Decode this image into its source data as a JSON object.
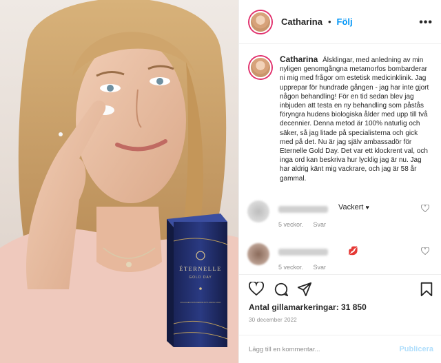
{
  "photo": {
    "box": {
      "brand": "ÉTERNELLE",
      "line": "GOLD DAY",
      "sub": "COLLAGEN SKIN REPAIR ANTI-AGING GOLD"
    }
  },
  "post": {
    "username": "Catharina",
    "separator": "•",
    "follow_label": "Följ",
    "more_icon": "more-options-icon",
    "caption_text": "Älsklingar, med anledning av min nyligen genomgångna metamorfos bombarderar ni mig med frågor om estetisk medicinklinik. Jag upprepar för hundrade gången - jag har inte gjort någon behandling! För en tid sedan blev jag inbjuden att testa en ny behandling som påstås föryngra hudens biologiska ålder med upp till två decennier. Denna metod är 100% naturlig och säker, så jag litade på specialisterna och gick med på det. Nu är jag själv ambassadör för Eternelle Gold Day. Det var ett klockrent val, och inga ord kan beskriva hur lycklig jag är nu. Jag har aldrig känt mig vackrare, och jag är 58 år gammal."
  },
  "comments": [
    {
      "text": "Vackert",
      "emoji": "♥",
      "age": "5 veckor.",
      "reply": "Svar"
    },
    {
      "text": "",
      "emoji": "💋",
      "age": "5 veckor.",
      "reply": "Svar"
    }
  ],
  "actions": {
    "likes": "Antal gillamarkeringar: 31 850",
    "date": "30 december 2022"
  },
  "composer": {
    "placeholder": "Lägg till en kommentar...",
    "publish_label": "Publicera"
  },
  "colors": {
    "follow": "#0095f6",
    "publish_disabled": "#b2dffc",
    "meta": "#8e8e8e",
    "story_ring": "#e1306c"
  }
}
